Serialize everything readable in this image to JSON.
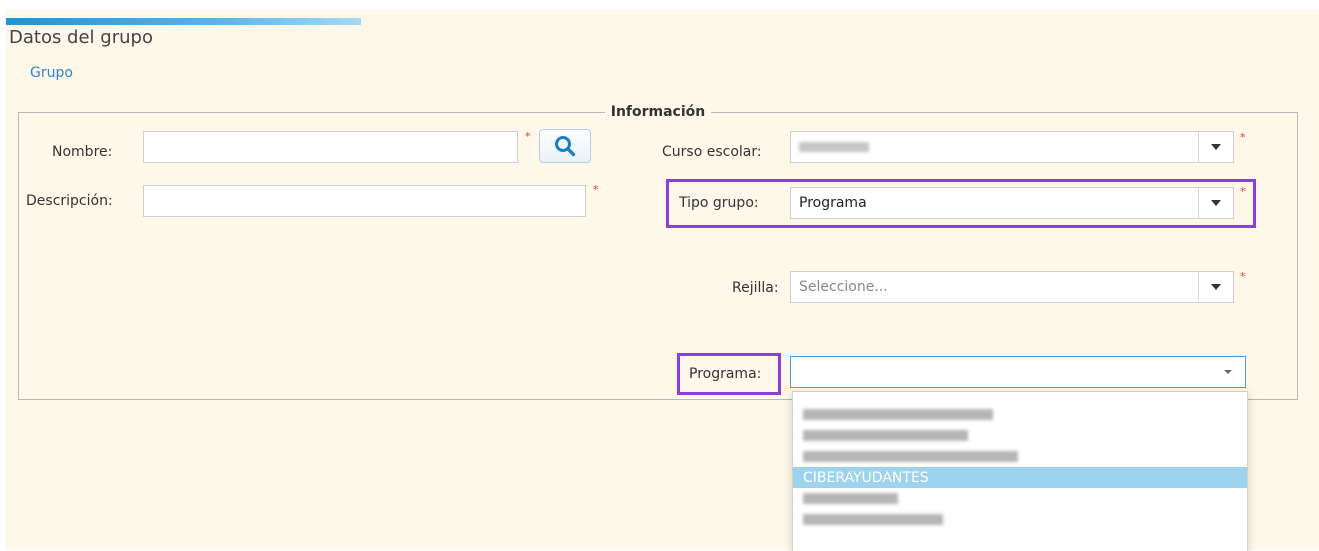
{
  "header": {
    "title": "Datos del grupo",
    "link": "Grupo"
  },
  "form": {
    "legend": "Información",
    "nombre_label": "Nombre:",
    "nombre_value": "",
    "descripcion_label": "Descripción:",
    "descripcion_value": "",
    "required_mark": "*",
    "curso_label": "Curso escolar:",
    "curso_value": "",
    "tipo_label": "Tipo grupo:",
    "tipo_value": "Programa",
    "rejilla_label": "Rejilla:",
    "rejilla_placeholder": "Seleccione...",
    "programa_label": "Programa:",
    "programa_value": ""
  },
  "programa_options": [
    {
      "label": "",
      "redacted": true
    },
    {
      "label": "",
      "redacted": true
    },
    {
      "label": "",
      "redacted": true
    },
    {
      "label": "CIBERAYUDANTES",
      "redacted": false,
      "selected": true
    },
    {
      "label": "",
      "redacted": true
    },
    {
      "label": "",
      "redacted": true
    }
  ],
  "icons": {
    "search": "search-icon",
    "dropdown": "chevron-down-icon"
  },
  "colors": {
    "accent": "#2f86c6",
    "highlight": "#8b3fd9",
    "selected_option": "#9ed3ee",
    "required": "#e23b3b",
    "panel_bg": "#fdf8e9"
  }
}
